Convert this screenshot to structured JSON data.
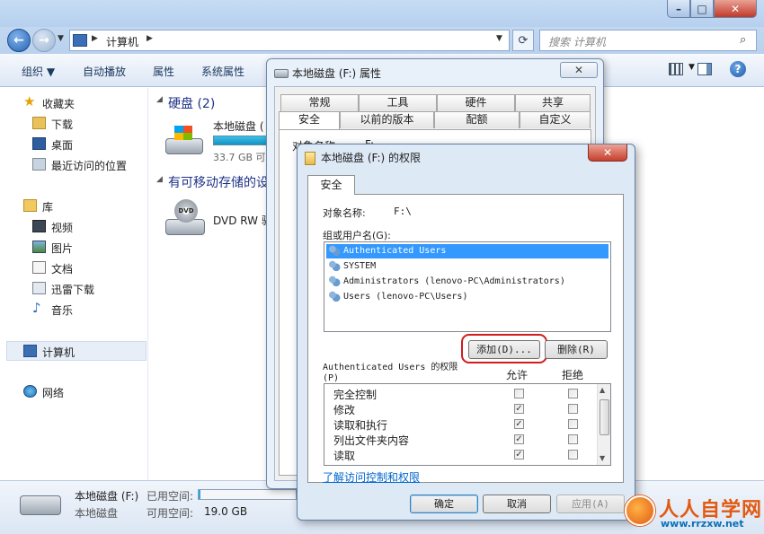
{
  "explorer": {
    "address_path": "计算机",
    "search_placeholder": "搜索 计算机",
    "toolbar": {
      "organize": "组织 ▼",
      "autoplay": "自动播放",
      "properties": "属性",
      "system_properties": "系统属性"
    },
    "sidebar": {
      "favorites": "收藏夹",
      "downloads": "下载",
      "desktop": "桌面",
      "recent": "最近访问的位置",
      "libraries": "库",
      "videos": "视频",
      "pictures": "图片",
      "documents": "文档",
      "xunlei": "迅雷下载",
      "music": "音乐",
      "computer": "计算机",
      "network": "网络"
    },
    "content": {
      "hdd_group": "硬盘 (2)",
      "drive_name": "本地磁盘 (",
      "drive_size": "33.7 GB 可",
      "removable_group": "有可移动存储的设",
      "dvd_name": "DVD RW 驱"
    },
    "status": {
      "drive_name": "本地磁盘 (F:)",
      "drive_type": "本地磁盘",
      "used_label": "已用空间:",
      "free_label": "可用空间:",
      "free_value": "19.0 GB"
    }
  },
  "properties_dialog": {
    "title": "本地磁盘 (F:) 属性",
    "tabs_row1": [
      "常规",
      "工具",
      "硬件",
      "共享"
    ],
    "tabs_row2": [
      "安全",
      "以前的版本",
      "配额",
      "自定义"
    ],
    "object_name_partial": "对象名称:",
    "object_value_partial": "F:"
  },
  "permissions_dialog": {
    "title": "本地磁盘 (F:) 的权限",
    "tab": "安全",
    "object_label": "对象名称:",
    "object_value": "F:\\",
    "group_label": "组或用户名(G):",
    "users": [
      "Authenticated Users",
      "SYSTEM",
      "Administrators (lenovo-PC\\Administrators)",
      "Users (lenovo-PC\\Users)"
    ],
    "add_button": "添加(D)...",
    "remove_button": "删除(R)",
    "perm_label_line1": "Authenticated Users 的权限",
    "perm_label_line2": "(P)",
    "allow_header": "允许",
    "deny_header": "拒绝",
    "permissions": [
      {
        "name": "完全控制",
        "allow": false,
        "deny": false
      },
      {
        "name": "修改",
        "allow": true,
        "deny": false
      },
      {
        "name": "读取和执行",
        "allow": true,
        "deny": false
      },
      {
        "name": "列出文件夹内容",
        "allow": true,
        "deny": false
      },
      {
        "name": "读取",
        "allow": true,
        "deny": false
      }
    ],
    "learn_link": "了解访问控制和权限",
    "ok_button": "确定",
    "cancel_button": "取消",
    "apply_button": "应用(A)"
  },
  "watermark": {
    "text": "人人自学网",
    "url": "www.rrzxw.net"
  },
  "colors": {
    "selection": "#3399ff",
    "highlight_ring": "#d21c1c",
    "link": "#0066cc"
  }
}
